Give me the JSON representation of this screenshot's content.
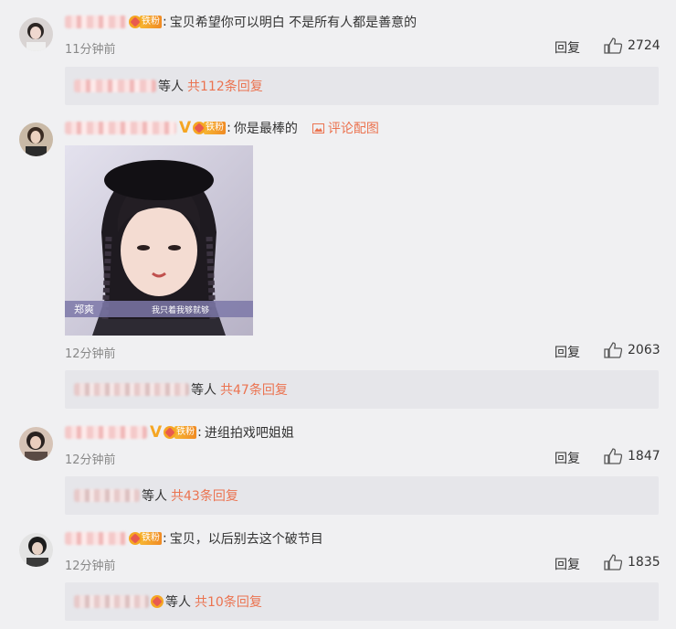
{
  "comments": [
    {
      "text": "宝贝希望你可以明白 不是所有人都是善意的",
      "time": "11分钟前",
      "reply_label": "回复",
      "likes": "2724",
      "fan_badge": "铁粉",
      "replies_who": "等人",
      "replies_more": "共112条回复"
    },
    {
      "text": "你是最棒的",
      "pic_link": "评论配图",
      "photo_caption_left": "郑爽",
      "photo_caption_right": "我只着我够就够",
      "time": "12分钟前",
      "reply_label": "回复",
      "likes": "2063",
      "fan_badge": "铁粉",
      "replies_who": "等人",
      "replies_more": "共47条回复"
    },
    {
      "text": "进组拍戏吧姐姐",
      "time": "12分钟前",
      "reply_label": "回复",
      "likes": "1847",
      "fan_badge": "铁粉",
      "replies_who": "等人",
      "replies_more": "共43条回复"
    },
    {
      "text": "宝贝，以后别去这个破节目",
      "time": "12分钟前",
      "reply_label": "回复",
      "likes": "1835",
      "fan_badge": "铁粉",
      "replies_who": "等人",
      "replies_more": "共10条回复"
    }
  ],
  "colors": {
    "accent": "#eb7350",
    "badge": "#f5a623",
    "background": "#f0f0f2"
  },
  "icons": {
    "like": "thumbs-up-icon",
    "picture": "image-icon",
    "vip": "verified-v-icon",
    "fan": "fan-badge-icon"
  }
}
